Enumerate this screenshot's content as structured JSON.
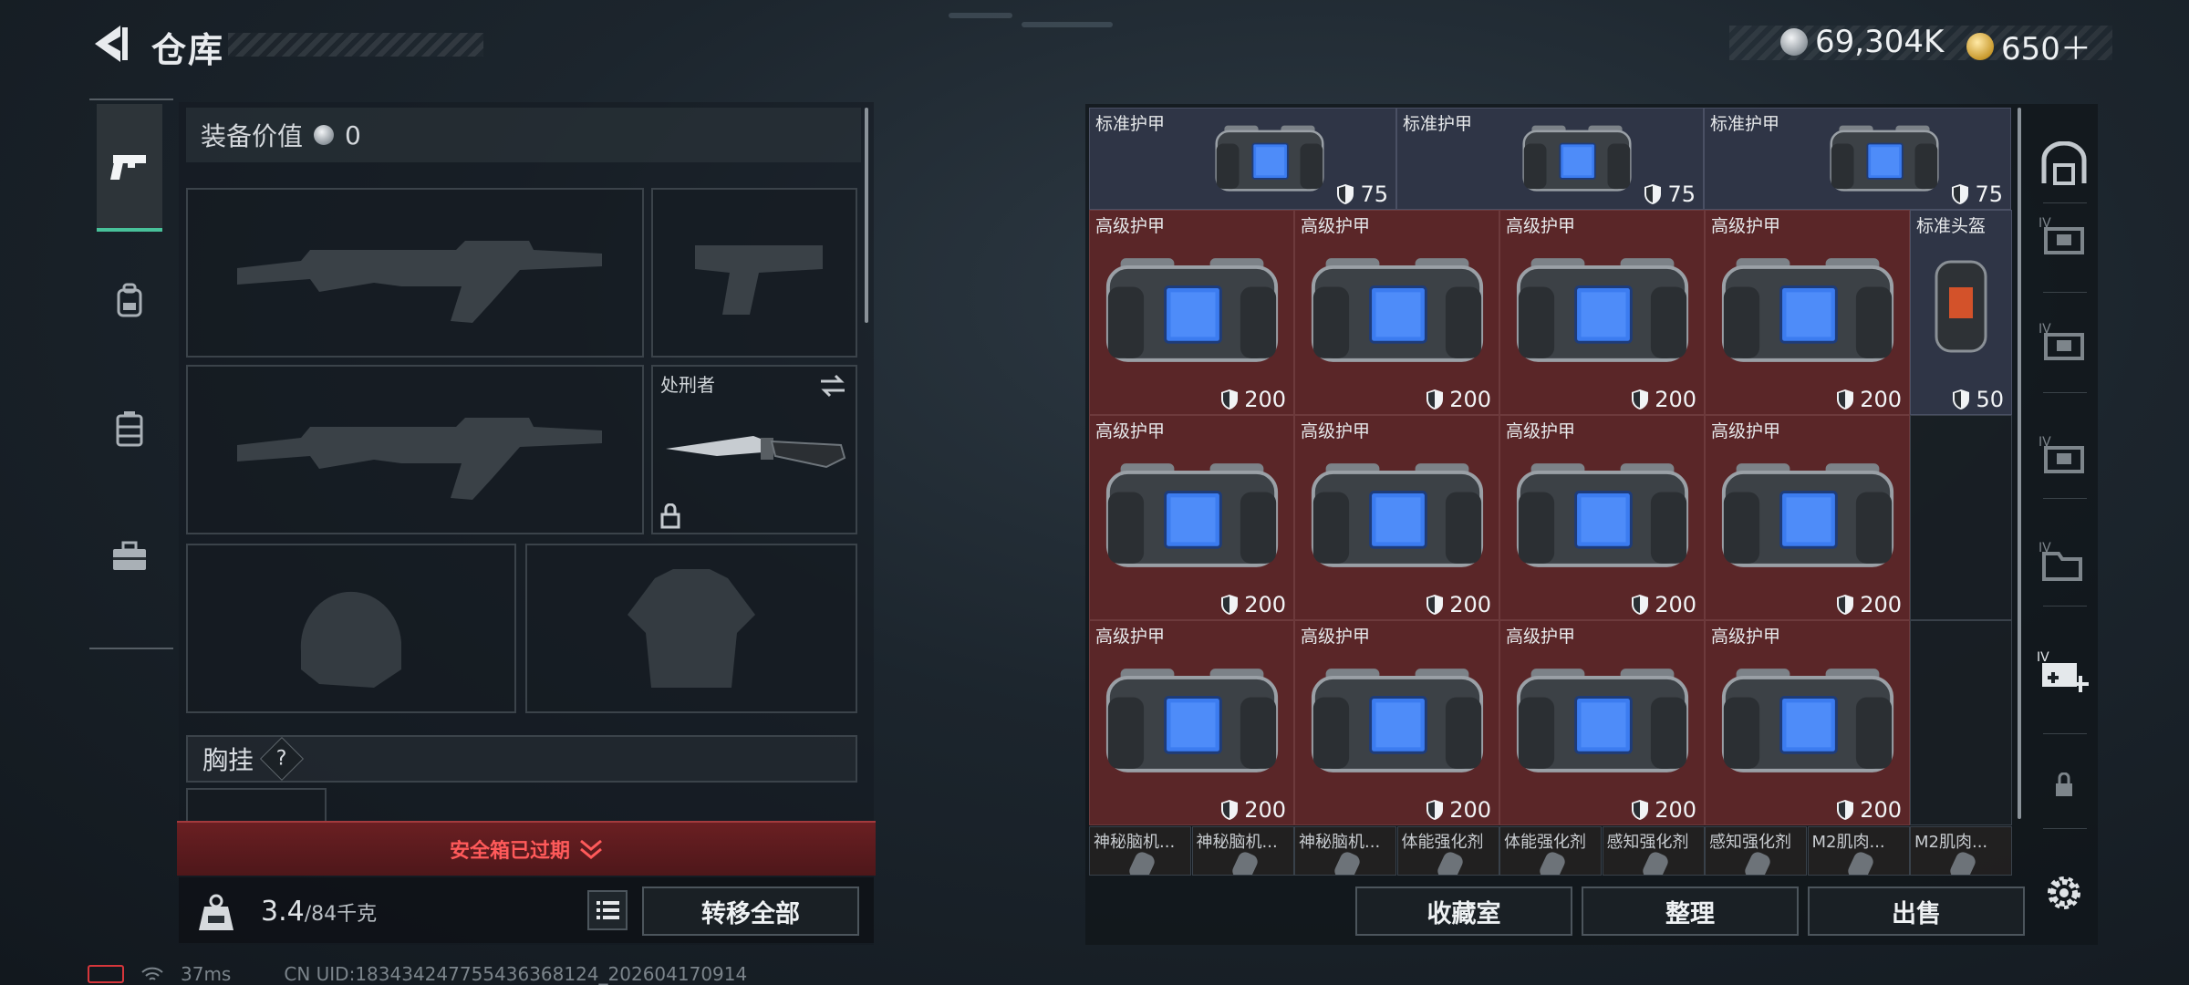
{
  "header": {
    "title": "仓库",
    "currencies": [
      {
        "icon": "silver-coin-icon",
        "value": "69,304K"
      },
      {
        "icon": "gold-coin-icon",
        "value": "650＋"
      }
    ]
  },
  "left_tabs": [
    {
      "icon": "pistol-icon",
      "active": true
    },
    {
      "icon": "backpack-icon",
      "active": false
    },
    {
      "icon": "vest-icon",
      "active": false
    },
    {
      "icon": "briefcase-icon",
      "active": false
    }
  ],
  "loadout": {
    "value_label": "装备价值",
    "value": "0",
    "melee_name": "处刑者",
    "chest_rig_label": "胸挂",
    "help_mark": "?",
    "safe_box_status": "安全箱已过期",
    "weight_current": "3.4",
    "weight_max": "/84千克",
    "transfer_all": "转移全部"
  },
  "storage": {
    "items": [
      {
        "name": "标准护甲",
        "value": "75",
        "kind": "blue"
      },
      {
        "name": "标准护甲",
        "value": "75",
        "kind": "blue"
      },
      {
        "name": "标准护甲",
        "value": "75",
        "kind": "blue"
      },
      {
        "name": "高级护甲",
        "value": "200",
        "kind": "red"
      },
      {
        "name": "高级护甲",
        "value": "200",
        "kind": "red"
      },
      {
        "name": "高级护甲",
        "value": "200",
        "kind": "red"
      },
      {
        "name": "高级护甲",
        "value": "200",
        "kind": "red"
      },
      {
        "name": "标准头盔",
        "value": "50",
        "kind": "blue"
      },
      {
        "name": "高级护甲",
        "value": "200",
        "kind": "red"
      },
      {
        "name": "高级护甲",
        "value": "200",
        "kind": "red"
      },
      {
        "name": "高级护甲",
        "value": "200",
        "kind": "red"
      },
      {
        "name": "高级护甲",
        "value": "200",
        "kind": "red"
      },
      {
        "name": "高级护甲",
        "value": "200",
        "kind": "red"
      },
      {
        "name": "高级护甲",
        "value": "200",
        "kind": "red"
      },
      {
        "name": "高级护甲",
        "value": "200",
        "kind": "red"
      },
      {
        "name": "高级护甲",
        "value": "200",
        "kind": "red"
      }
    ],
    "small_items": [
      "神秘脑机...",
      "神秘脑机...",
      "神秘脑机...",
      "体能强化剂",
      "体能强化剂",
      "感知强化剂",
      "感知强化剂",
      "M2肌肉...",
      "M2肌肉..."
    ],
    "buttons": {
      "collection": "收藏室",
      "sort": "整理",
      "sell": "出售"
    }
  },
  "right_tabs": [
    "storage-home-icon",
    "storage-box-iv-icon",
    "storage-box-iv-icon",
    "storage-box-iv-icon",
    "storage-folder-iv-icon",
    "add-storage-icon",
    "lock-icon",
    "settings-icon"
  ],
  "status": {
    "ping": "37ms",
    "uid": "CN UID:1834342477554363681​24_202604170914"
  },
  "colors": {
    "accent": "#48c19a",
    "alert": "#ff5a5a",
    "rare_red": "#5a2628",
    "common_blue": "#2f3546"
  }
}
